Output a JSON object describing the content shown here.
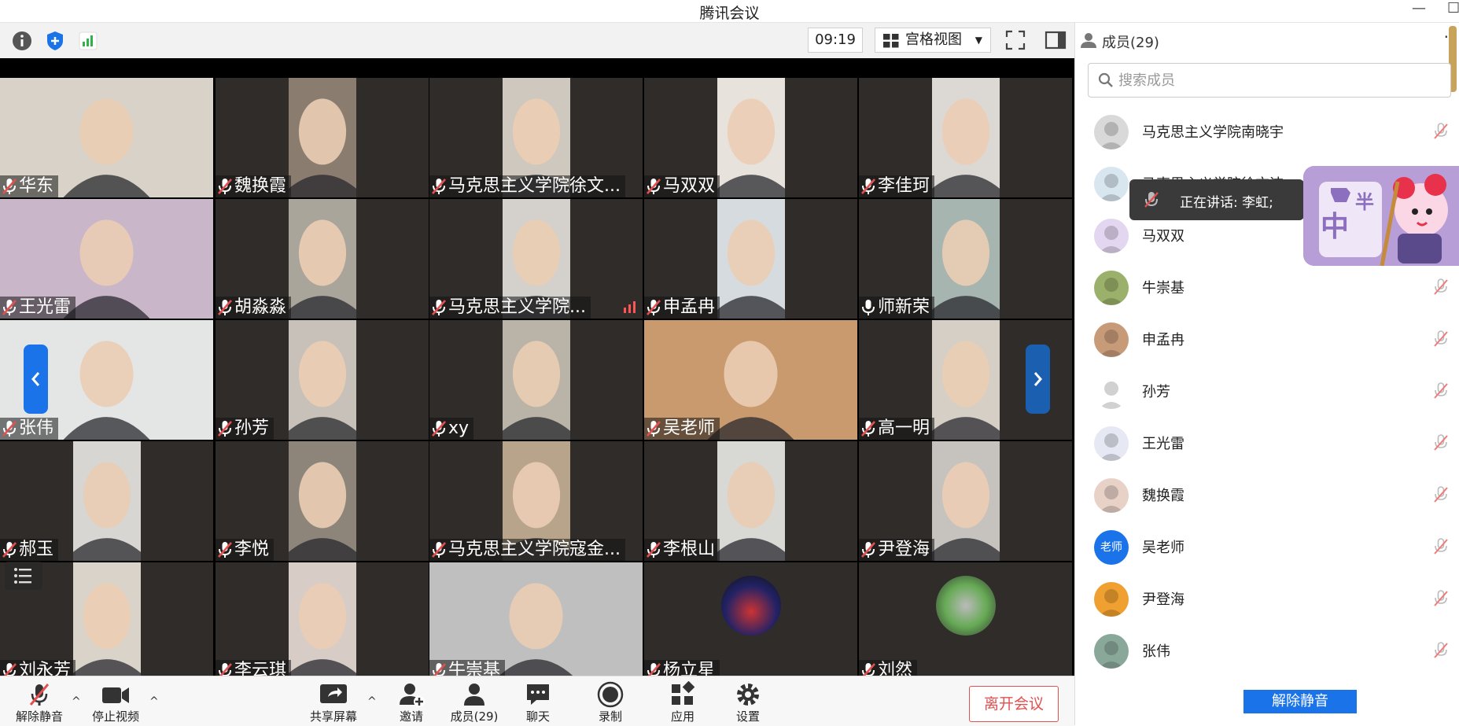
{
  "window": {
    "title": "腾讯会议",
    "minimize": "—",
    "maximize": "☐"
  },
  "toolbar": {
    "timer": "09:19",
    "view_label": "宫格视图"
  },
  "tiles": [
    {
      "name": "华东",
      "bg": "#d8d2c8"
    },
    {
      "name": "魏换霞",
      "bg": "#8a7d70"
    },
    {
      "name": "马克思主义学院徐文...",
      "bg": "#cfc8bf"
    },
    {
      "name": "马双双",
      "bg": "#e8e2dc"
    },
    {
      "name": "李佳珂",
      "bg": "#dcd8d4"
    },
    {
      "name": "王光雷",
      "bg": "#c9b7c9"
    },
    {
      "name": "胡淼淼",
      "bg": "#a9a59a"
    },
    {
      "name": "马克思主义学院...",
      "bg": "#d4d0cc"
    },
    {
      "name": "申孟冉",
      "bg": "#d6dbe0"
    },
    {
      "name": "师新荣",
      "bg": "#a6b5b0"
    },
    {
      "name": "张伟",
      "bg": "#e4e6e6"
    },
    {
      "name": "孙芳",
      "bg": "#c7c1b9"
    },
    {
      "name": "xy",
      "bg": "#b9b3a8"
    },
    {
      "name": "吴老师",
      "bg": "#c99a6e"
    },
    {
      "name": "高一明",
      "bg": "#d6cfc6"
    },
    {
      "name": "郝玉",
      "bg": "#d8d6d2"
    },
    {
      "name": "李悦",
      "bg": "#8d857a"
    },
    {
      "name": "马克思主义学院寇金...",
      "bg": "#b8a48a"
    },
    {
      "name": "李根山",
      "bg": "#d8d8d5"
    },
    {
      "name": "尹登海",
      "bg": "#c6c3be"
    },
    {
      "name": "刘永芳",
      "bg": "#d9d3ca"
    },
    {
      "name": "李云琪",
      "bg": "#d7ccc6"
    },
    {
      "name": "牛崇基",
      "bg": "#bfbfbf"
    },
    {
      "name": "杨立星",
      "bg": "#2f2c29"
    },
    {
      "name": "刘然",
      "bg": "#2f2c29"
    }
  ],
  "bottombar": {
    "unmute": "解除静音",
    "stop_video": "停止视频",
    "share": "共享屏幕",
    "invite": "邀请",
    "members": "成员(29)",
    "chat": "聊天",
    "record": "录制",
    "apps": "应用",
    "settings": "设置",
    "leave": "离开会议"
  },
  "panel": {
    "header": "成员(29)",
    "more": "·",
    "search_placeholder": "搜索成员",
    "members": [
      {
        "name": "马克思主义学院南晓宇",
        "color": "#d9d9d9"
      },
      {
        "name": "马克思主义学院徐文洁",
        "color": "#d8e6ef"
      },
      {
        "name": "马双双",
        "color": "#e3d6f0"
      },
      {
        "name": "牛崇基",
        "color": "#9bb06b"
      },
      {
        "name": "申孟冉",
        "color": "#c79a78"
      },
      {
        "name": "孙芳",
        "color": "#ffffff"
      },
      {
        "name": "王光雷",
        "color": "#e6e8f3"
      },
      {
        "name": "魏换霞",
        "color": "#e8d2c8"
      },
      {
        "name": "吴老师",
        "color": "#1a73e8",
        "badge": "老师"
      },
      {
        "name": "尹登海",
        "color": "#f0a030"
      },
      {
        "name": "张伟",
        "color": "#8aa89a"
      }
    ],
    "speaking_prefix": "正在讲话: 李虹;",
    "sticker_text": "中",
    "sticker_small": "半",
    "unmute_all": "解除静音"
  }
}
